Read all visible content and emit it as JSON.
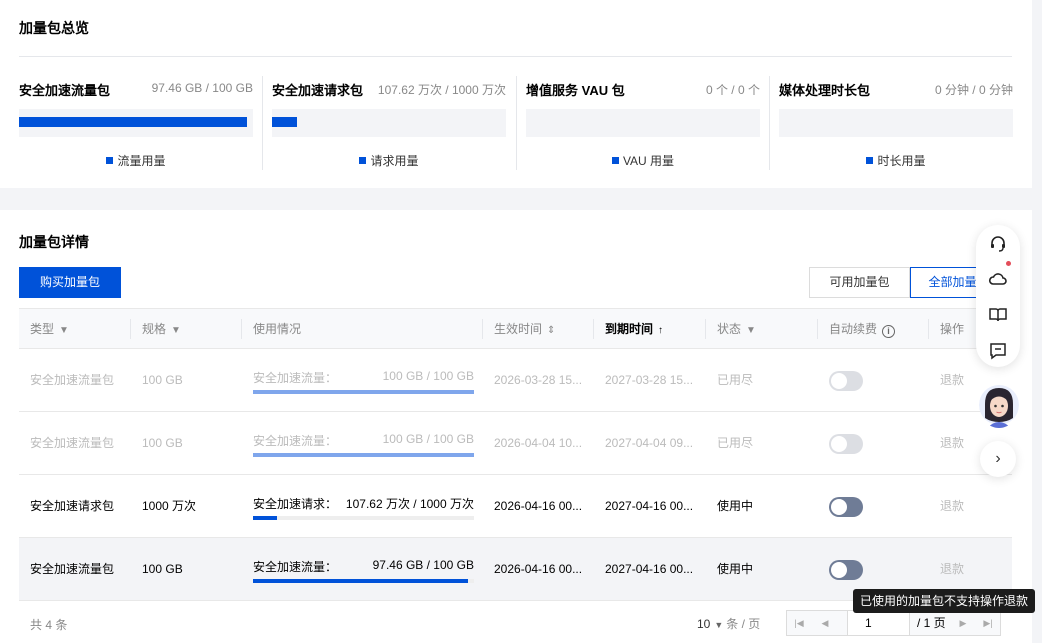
{
  "overview": {
    "title": "加量包总览",
    "packages": [
      {
        "name": "安全加速流量包",
        "amount": "97.46 GB / 100 GB",
        "legend": "流量用量",
        "usage_fraction": 0.975
      },
      {
        "name": "安全加速请求包",
        "amount": "107.62 万次 / 1000 万次",
        "legend": "请求用量",
        "usage_fraction": 0.108
      },
      {
        "name": "增值服务 VAU 包",
        "amount": "0 个 / 0 个",
        "legend": "VAU 用量",
        "usage_fraction": 0
      },
      {
        "name": "媒体处理时长包",
        "amount": "0 分钟 / 0 分钟",
        "legend": "时长用量",
        "usage_fraction": 0
      }
    ]
  },
  "details": {
    "title": "加量包详情",
    "buy_button": "购买加量包",
    "filters": [
      {
        "label": "可用加量包",
        "active": false
      },
      {
        "label": "全部加量包",
        "active": true
      }
    ],
    "columns": {
      "type": "类型",
      "spec": "规格",
      "usage": "使用情况",
      "start": "生效时间",
      "end": "到期时间",
      "status": "状态",
      "autorenew": "自动续费",
      "action": "操作"
    },
    "rows": [
      {
        "type": "安全加速流量包",
        "spec": "100 GB",
        "usage_label": "安全加速流量：",
        "usage_value": "100 GB / 100 GB",
        "usage_fraction": 1.0,
        "start": "2026-03-28 15...",
        "end": "2027-03-28 15...",
        "status": "已用尽",
        "action": "退款",
        "dim": true,
        "autorenew": false
      },
      {
        "type": "安全加速流量包",
        "spec": "100 GB",
        "usage_label": "安全加速流量：",
        "usage_value": "100 GB / 100 GB",
        "usage_fraction": 1.0,
        "start": "2026-04-04 10...",
        "end": "2027-04-04 09...",
        "status": "已用尽",
        "action": "退款",
        "dim": true,
        "autorenew": false
      },
      {
        "type": "安全加速请求包",
        "spec": "1000 万次",
        "usage_label": "安全加速请求：",
        "usage_value": "107.62 万次 / 1000 万次",
        "usage_fraction": 0.108,
        "start": "2026-04-16 00...",
        "end": "2027-04-16 00...",
        "status": "使用中",
        "action": "退款",
        "dim": false,
        "autorenew": true
      },
      {
        "type": "安全加速流量包",
        "spec": "100 GB",
        "usage_label": "安全加速流量：",
        "usage_value": "97.46 GB / 100 GB",
        "usage_fraction": 0.975,
        "start": "2026-04-16 00...",
        "end": "2027-04-16 00...",
        "status": "使用中",
        "action": "退款",
        "dim": false,
        "autorenew": true
      }
    ],
    "footer": {
      "total": "共 4 条",
      "page_size": "10",
      "per_page": "条 / 页",
      "page": "1",
      "page_total": "/ 1 页"
    }
  },
  "tooltip": "已使用的加量包不支持操作退款",
  "colors": {
    "accent": "#0052d9",
    "toggle_on": "#6f7c96",
    "badge": "#e34d59"
  }
}
